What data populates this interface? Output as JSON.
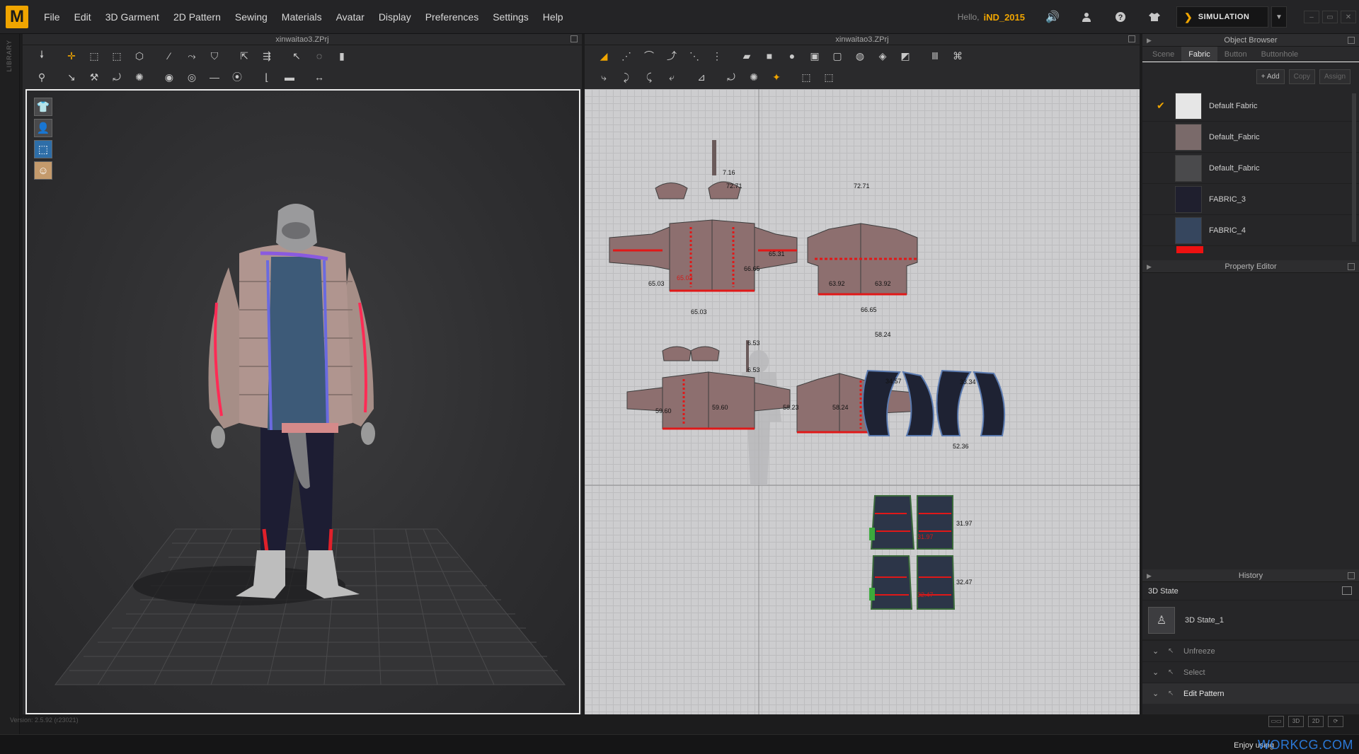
{
  "menubar": {
    "logo": "M",
    "items": [
      "File",
      "Edit",
      "3D Garment",
      "2D Pattern",
      "Sewing",
      "Materials",
      "Avatar",
      "Display",
      "Preferences",
      "Settings",
      "Help"
    ],
    "hello": "Hello,",
    "username": "iND_2015",
    "simulation_label": "SIMULATION"
  },
  "library_label": "LIBRARY",
  "panel3d": {
    "title": "xinwaitao3.ZPrj"
  },
  "panel2d": {
    "title": "xinwaitao3.ZPrj"
  },
  "pattern_labels": {
    "m1": "72.71",
    "m2": "65.31",
    "m3": "63.92",
    "m4": "58.24",
    "m5": "66.65",
    "m6": "59.60",
    "m7": "6.53",
    "m8": "34.57",
    "m9": "33.34",
    "m10": "31.97",
    "m11": "32.47",
    "m12": "7.16",
    "m13": "58.23",
    "m14": "65.03",
    "m15": "52.36"
  },
  "object_browser": {
    "title": "Object Browser",
    "tabs": [
      "Scene",
      "Fabric",
      "Button",
      "Buttonhole"
    ],
    "active_tab": "Fabric",
    "actions": [
      "+ Add",
      "Copy",
      "Assign"
    ],
    "fabrics": [
      {
        "name": "Default Fabric",
        "color": "#e6e6e6",
        "checked": "✔"
      },
      {
        "name": "Default_Fabric",
        "color": "#7a6a6a",
        "checked": ""
      },
      {
        "name": "Default_Fabric",
        "color": "#4a4a4c",
        "checked": ""
      },
      {
        "name": "FABRIC_3",
        "color": "#1f1f2e",
        "checked": ""
      },
      {
        "name": "FABRIC_4",
        "color": "#36465e",
        "checked": ""
      }
    ]
  },
  "property_editor": {
    "title": "Property Editor"
  },
  "history": {
    "title": "History",
    "subheader": "3D State",
    "state": "3D State_1",
    "items": [
      "Unfreeze",
      "Select",
      "Edit Pattern"
    ]
  },
  "version": "Version: 2.5.92   (r23021)",
  "footer": {
    "enjoy": "Enjoy using",
    "site": "WORKCG.COM"
  },
  "colors": {
    "accent": "#f0a500",
    "grid2d": "#cdcdcf",
    "site_blue": "#2b78d6"
  }
}
